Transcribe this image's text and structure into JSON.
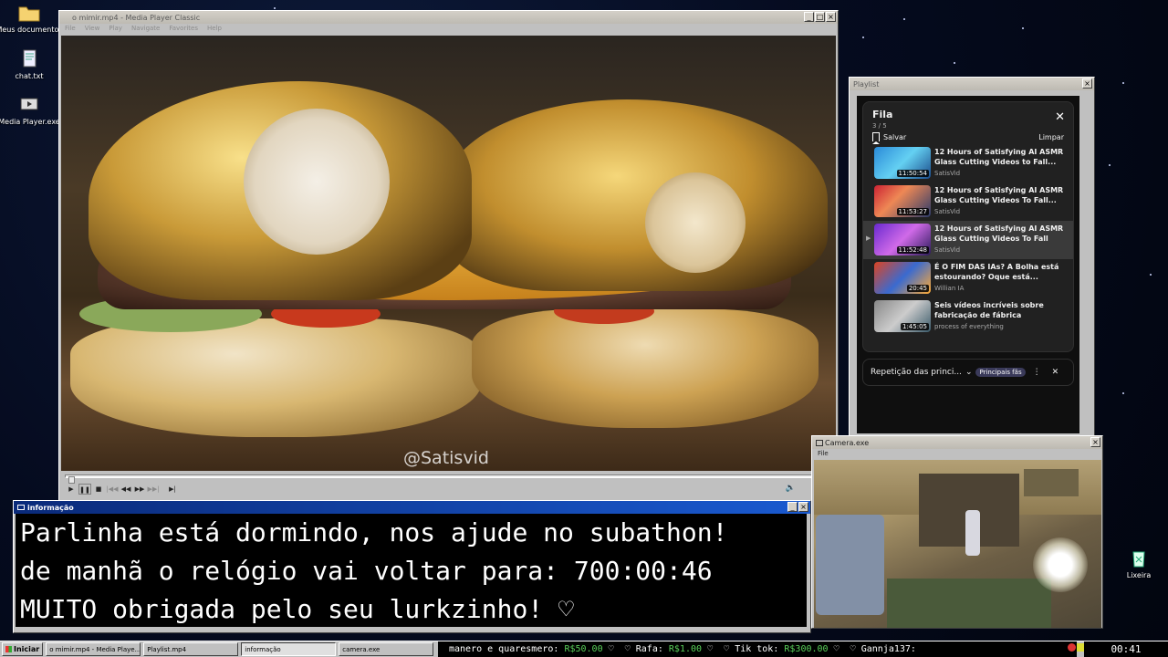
{
  "desktop": {
    "icons": [
      {
        "label": "Meus documentos",
        "icon": "folder-icon"
      },
      {
        "label": "chat.txt",
        "icon": "text-file-icon"
      },
      {
        "label": "Media Player.exe",
        "icon": "media-player-icon"
      },
      {
        "label": "Lixeira",
        "icon": "recycle-bin-icon"
      }
    ]
  },
  "player": {
    "title": "o mimir.mp4 - Media Player Classic",
    "menu": [
      "File",
      "View",
      "Play",
      "Navigate",
      "Favorites",
      "Help"
    ],
    "watermark": "@Satisvid",
    "progress": 0.004
  },
  "playlist": {
    "window_title": "Playlist",
    "queue_title": "Fila",
    "count": "3 / 5",
    "save_label": "Salvar",
    "clear_label": "Limpar",
    "items": [
      {
        "title": "12 Hours of Satisfying AI ASMR Glass Cutting Videos to Fall...",
        "channel": "SatisVid",
        "duration": "11:50:54",
        "current": false
      },
      {
        "title": "12 Hours of Satisfying AI ASMR Glass Cutting Videos To Fall...",
        "channel": "SatisVid",
        "duration": "11:53:27",
        "current": false
      },
      {
        "title": "12 Hours of Satisfying AI ASMR Glass Cutting Videos To Fall Asleep To",
        "channel": "SatisVid",
        "duration": "11:52:48",
        "current": true
      },
      {
        "title": "É O FIM DAS IAs? A Bolha está estourando? Oque está...",
        "channel": "Willian IA",
        "duration": "20:45",
        "current": false
      },
      {
        "title": "Seis vídeos incríveis sobre fabricação de fábrica",
        "channel": "process of everything",
        "duration": "1:45:05",
        "current": false
      }
    ],
    "loop_label": "Repetição das princi...",
    "chip_label": "Principais fãs"
  },
  "camera": {
    "title": "Camera.exe",
    "menu": "File"
  },
  "info": {
    "title": "informação",
    "lines": [
      "Parlinha está dormindo, nos ajude no subathon!",
      "de manhã o relógio vai voltar para:  700:00:46",
      "MUITO obrigada pelo seu lurkzinho! ♡"
    ]
  },
  "taskbar": {
    "start": "Iniciar",
    "tasks": [
      {
        "label": "o mimir.mp4 - Media Playe...",
        "active": false
      },
      {
        "label": "Playlist.mp4",
        "active": false
      },
      {
        "label": "informação",
        "active": true
      },
      {
        "label": "camera.exe",
        "active": false
      }
    ],
    "ticker": [
      {
        "name": "manero e quaresmero:",
        "amount": "R$50.00"
      },
      {
        "name": "Rafa:",
        "amount": "R$1.00"
      },
      {
        "name": "Tik tok:",
        "amount": "R$300.00"
      },
      {
        "name": "Gannja137:",
        "amount": ""
      }
    ],
    "clock": "00:41"
  },
  "colors": {
    "accent_blue": "#0a2a7a",
    "ticker_amount": "#5ad15a",
    "yt_bg": "#0f0f0f"
  }
}
